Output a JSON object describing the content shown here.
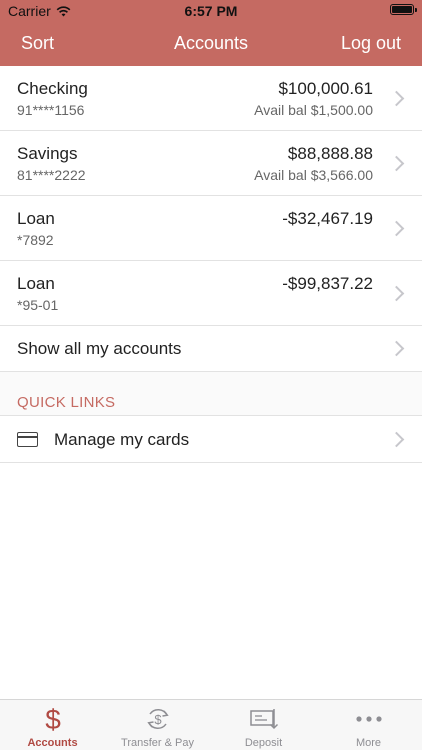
{
  "status": {
    "carrier": "Carrier",
    "time": "6:57 PM"
  },
  "nav": {
    "left": "Sort",
    "title": "Accounts",
    "right": "Log out"
  },
  "accounts": [
    {
      "name": "Checking",
      "number": "91****1156",
      "balance": "$100,000.61",
      "available": "Avail bal $1,500.00"
    },
    {
      "name": "Savings",
      "number": "81****2222",
      "balance": "$88,888.88",
      "available": "Avail bal $3,566.00"
    },
    {
      "name": "Loan",
      "number": "*7892",
      "balance": "-$32,467.19",
      "available": ""
    },
    {
      "name": "Loan",
      "number": "*95-01",
      "balance": "-$99,837.22",
      "available": ""
    }
  ],
  "show_all": "Show all my accounts",
  "quick_links": {
    "header": "QUICK LINKS",
    "items": [
      {
        "label": "Manage my cards",
        "icon": "card-icon"
      }
    ]
  },
  "tabs": [
    {
      "label": "Accounts",
      "icon": "dollar-icon",
      "active": true
    },
    {
      "label": "Transfer & Pay",
      "icon": "transfer-icon",
      "active": false
    },
    {
      "label": "Deposit",
      "icon": "deposit-check-icon",
      "active": false
    },
    {
      "label": "More",
      "icon": "more-icon",
      "active": false
    }
  ],
  "colors": {
    "accent": "#c56a62",
    "active_tab": "#b04a43",
    "inactive_tab": "#8e8e93",
    "chevron": "#c7c7cc"
  }
}
